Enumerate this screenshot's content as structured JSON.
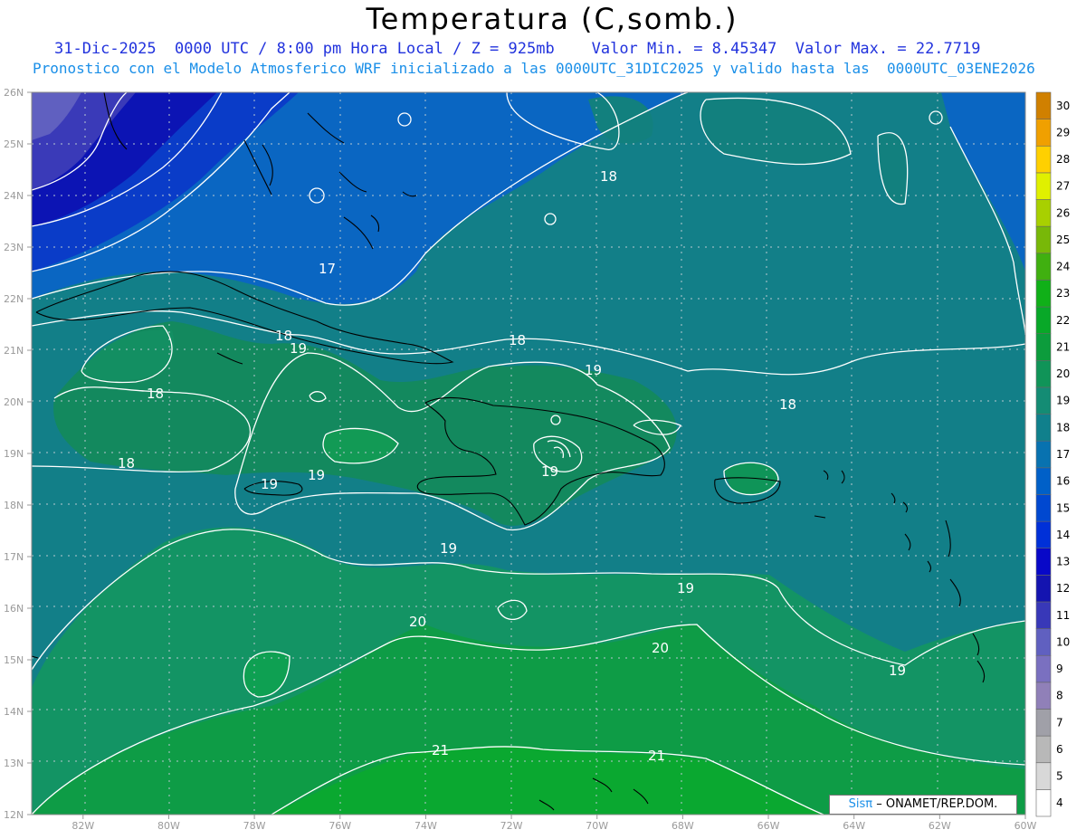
{
  "header": {
    "title": "Temperatura (C,somb.)",
    "line1": "31-Dic-2025  0000 UTC / 8:00 pm Hora Local / Z = 925mb    Valor Min. = 8.45347  Valor Max. = 22.7719",
    "line2": "Pronostico con el Modelo Atmosferico WRF inicializado a las 0000UTC_31DIC2025 y valido hasta las  0000UTC_03ENE2026"
  },
  "credit": {
    "logo": "Sisπ",
    "text": "– ONAMET/REP.DOM."
  },
  "axes": {
    "lat_labels": [
      "26N",
      "25N",
      "24N",
      "23N",
      "22N",
      "21N",
      "20N",
      "19N",
      "18N",
      "17N",
      "16N",
      "15N",
      "14N",
      "13N",
      "12N"
    ],
    "lon_labels": [
      "82W",
      "80W",
      "78W",
      "76W",
      "74W",
      "72W",
      "70W",
      "68W",
      "66W",
      "64W",
      "62W",
      "60W"
    ],
    "lat_range": [
      12,
      26
    ],
    "lon_range": [
      -83.2,
      -60
    ]
  },
  "colorbar": {
    "levels": [
      "4",
      "5",
      "6",
      "7",
      "8",
      "9",
      "10",
      "11",
      "12",
      "13",
      "14",
      "15",
      "16",
      "17",
      "18",
      "19",
      "20",
      "21",
      "22",
      "23",
      "24",
      "25",
      "26",
      "27",
      "28",
      "29",
      "30"
    ],
    "colors": [
      "#ffffff",
      "#d8d8d8",
      "#b8b8b8",
      "#a0a0a8",
      "#9080b8",
      "#7a70c0",
      "#6060c0",
      "#3838b8",
      "#1414b0",
      "#0808c8",
      "#0030d8",
      "#0048d0",
      "#0060c8",
      "#0872b0",
      "#10808c",
      "#148c74",
      "#109458",
      "#0c9c3c",
      "#08a828",
      "#10b018",
      "#40b010",
      "#78b808",
      "#a8d000",
      "#e0f000",
      "#ffd000",
      "#f0a000",
      "#d08000"
    ]
  },
  "contours": [
    {
      "label": "17"
    },
    {
      "label": "18"
    },
    {
      "label": "19"
    },
    {
      "label": "20"
    },
    {
      "label": "21"
    }
  ]
}
